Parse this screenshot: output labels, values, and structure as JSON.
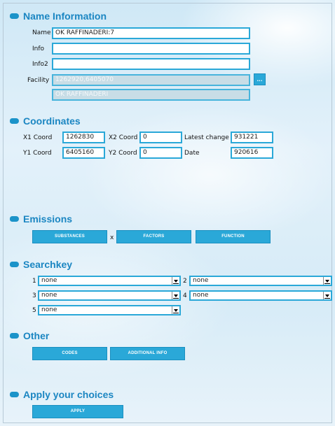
{
  "sections": {
    "name_information": "Name Information",
    "coordinates": "Coordinates",
    "emissions": "Emissions",
    "searchkey": "Searchkey",
    "other": "Other",
    "apply": "Apply your choices"
  },
  "name_info": {
    "name_label": "Name",
    "name_value": "OK RAFFINADERI:7",
    "info_label": "Info",
    "info_value": "",
    "info2_label": "Info2",
    "info2_value": "",
    "facility_label": "Facility",
    "facility_value": "1262920,6405070",
    "facility_button": "...",
    "facility_name": "OK RAFFINADERI"
  },
  "coordinates": {
    "x1_label": "X1 Coord",
    "x1_value": "1262830",
    "x2_label": "X2 Coord",
    "x2_value": "0",
    "latest_change_label": "Latest change",
    "latest_change_value": "931221",
    "y1_label": "Y1 Coord",
    "y1_value": "6405160",
    "y2_label": "Y2 Coord",
    "y2_value": "0",
    "date_label": "Date",
    "date_value": "920616"
  },
  "emissions": {
    "substances": "SUBSTANCES",
    "separator": "x",
    "factors": "FACTORS",
    "function": "FUNCTION"
  },
  "searchkey": {
    "keys": [
      {
        "number": "1",
        "value": "none"
      },
      {
        "number": "2",
        "value": "none"
      },
      {
        "number": "3",
        "value": "none"
      },
      {
        "number": "4",
        "value": "none"
      },
      {
        "number": "5",
        "value": "none"
      }
    ]
  },
  "other": {
    "codes": "CODES",
    "additional_info": "ADDITIONAL INFO"
  },
  "apply": {
    "button": "APPLY"
  },
  "colors": {
    "accent": "#2aa8d8",
    "title": "#1b86c2"
  }
}
